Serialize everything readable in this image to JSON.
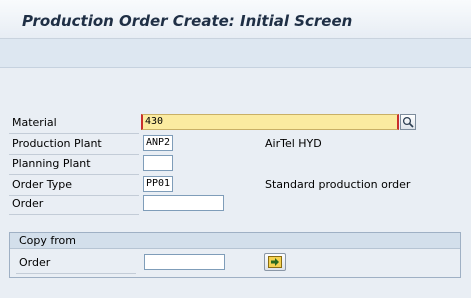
{
  "title": "Production Order Create: Initial Screen",
  "fields": {
    "material": {
      "label": "Material",
      "value": "430"
    },
    "production_plant": {
      "label": "Production Plant",
      "value": "ANP2",
      "description": "AirTel HYD"
    },
    "planning_plant": {
      "label": "Planning Plant",
      "value": ""
    },
    "order_type": {
      "label": "Order Type",
      "value": "PP01",
      "description": "Standard production order"
    },
    "order": {
      "label": "Order",
      "value": ""
    }
  },
  "copy_from": {
    "heading": "Copy from",
    "order_label": "Order",
    "order_value": ""
  },
  "icons": {
    "search_help": "magnifier-icon",
    "execute": "arrow-right-icon"
  },
  "colors": {
    "required_field": "#fbeba0",
    "required_marker": "#c9302c",
    "background": "#e9eef4"
  }
}
